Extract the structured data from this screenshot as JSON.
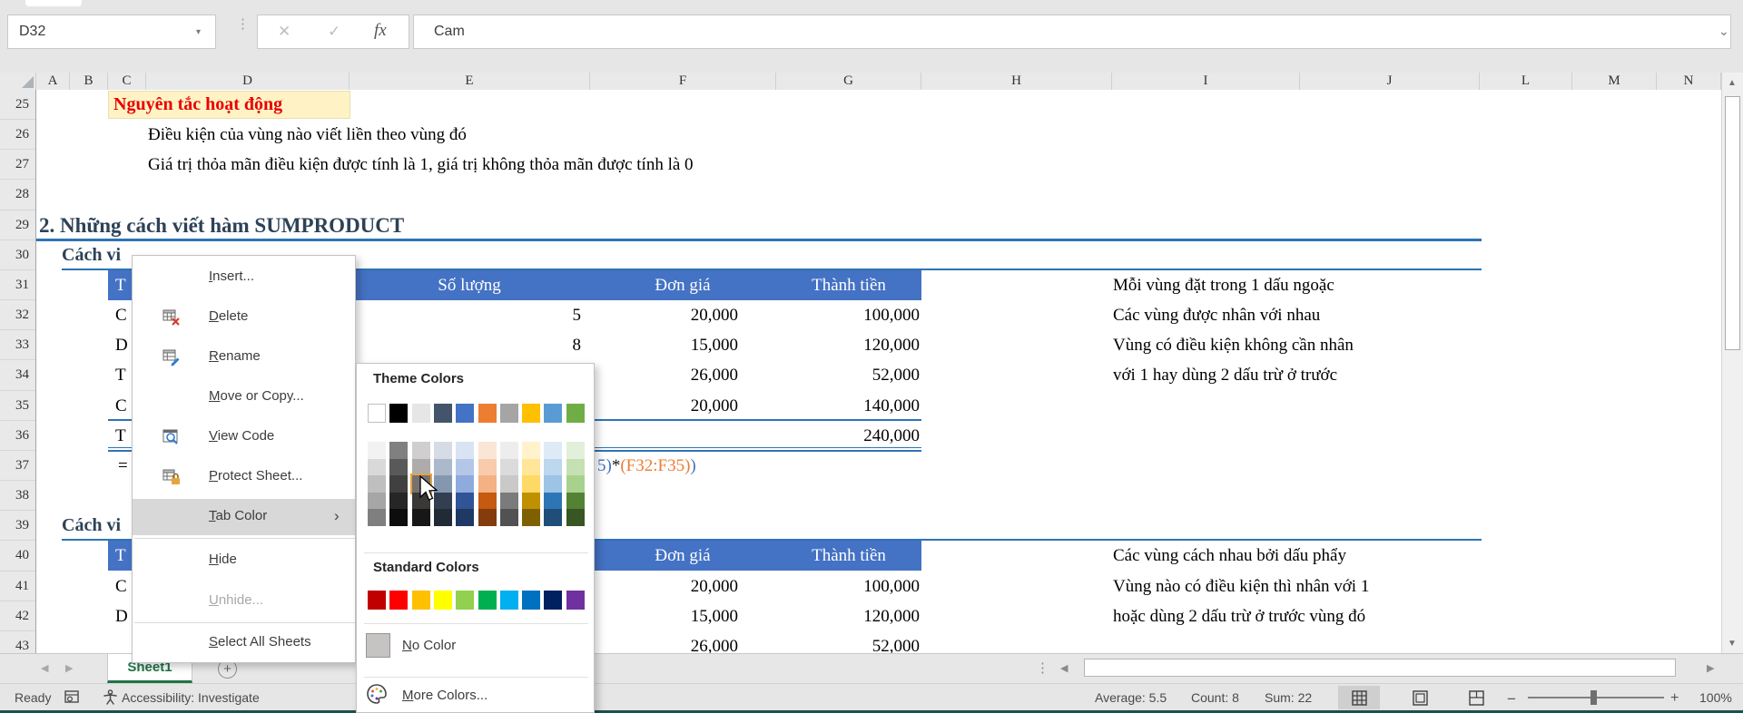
{
  "colors": {
    "accent_blue": "#4472C4",
    "line_blue": "#2E74B5",
    "heading_navy": "#2D4257",
    "note_red": "#EA0000",
    "note_bg": "#FFF3C5",
    "tab_green": "#217346",
    "formula_orange": "#ED7D31",
    "menu_highlight": "#D8D8D8"
  },
  "formula_bar": {
    "name_box": "D32",
    "cancel": "✕",
    "enter": "✓",
    "fx": "fx",
    "value": "Cam"
  },
  "grid": {
    "columns": [
      "A",
      "B",
      "C",
      "D",
      "E",
      "F",
      "G",
      "H",
      "I",
      "J",
      "L",
      "M",
      "N"
    ],
    "row_numbers": [
      "25",
      "26",
      "27",
      "28",
      "29",
      "30",
      "31",
      "32",
      "33",
      "34",
      "35",
      "36",
      "37",
      "38",
      "39",
      "40",
      "41",
      "42",
      "43"
    ]
  },
  "sheet": {
    "note_title": "Nguyên tắc hoạt động",
    "rule_line_1": "Điều kiện của vùng nào viết liền theo vùng đó",
    "rule_line_2": "Giá trị thỏa mãn điều kiện được tính là 1, giá trị không thỏa mãn được tính là 0",
    "section_heading": "2. Những cách viết hàm SUMPRODUCT",
    "sub_heading_1": "Cách vi",
    "sub_heading_2": "Cách vi",
    "table1": {
      "first_col_header": "T",
      "headers": [
        "Số lượng",
        "Đơn giá",
        "Thành tiền"
      ],
      "rows": [
        {
          "letter": "C",
          "qty": "5",
          "price": "20,000",
          "amount": "100,000"
        },
        {
          "letter": "D",
          "qty": "8",
          "price": "15,000",
          "amount": "120,000"
        },
        {
          "letter": "T",
          "qty": "",
          "price": "26,000",
          "amount": "52,000"
        },
        {
          "letter": "C",
          "qty": "",
          "price": "20,000",
          "amount": "140,000"
        }
      ],
      "total_letter": "T",
      "total": "240,000"
    },
    "formula_start": "=",
    "formula_fragment": [
      {
        "text": "5)",
        "color": "#4472C4"
      },
      {
        "text": "*",
        "color": "#1a1a1a"
      },
      {
        "text": "(F32:F35)",
        "color": "#ED7D31"
      },
      {
        "text": ")",
        "color": "#4472C4"
      }
    ],
    "table2": {
      "first_col_header": "T",
      "headers": [
        "Đơn giá",
        "Thành tiền"
      ],
      "rows": [
        {
          "letter": "C",
          "price": "20,000",
          "amount": "100,000"
        },
        {
          "letter": "D",
          "price": "15,000",
          "amount": "120,000"
        },
        {
          "letter": "",
          "price": "26,000",
          "amount": "52,000"
        }
      ]
    },
    "notes_block_1": [
      "Mỗi vùng đặt trong 1 dấu ngoặc",
      "Các vùng được nhân với nhau",
      "Vùng có điều kiện không cần nhân",
      "với 1 hay dùng 2 dấu trừ ở trước"
    ],
    "notes_block_2": [
      "Các vùng cách nhau bởi dấu phẩy",
      "Vùng nào có điều kiện thì nhân với 1",
      "hoặc dùng 2 dấu trừ ở trước vùng đó"
    ]
  },
  "context_menu": {
    "items": [
      {
        "label": "Insert...",
        "icon": "",
        "disabled": false,
        "submenu": false,
        "highlighted": false
      },
      {
        "label": "Delete",
        "icon": "delete-table-icon",
        "disabled": false,
        "submenu": false,
        "highlighted": false
      },
      {
        "label": "Rename",
        "icon": "rename-icon",
        "disabled": false,
        "submenu": false,
        "highlighted": false
      },
      {
        "label": "Move or Copy...",
        "icon": "",
        "disabled": false,
        "submenu": false,
        "highlighted": false
      },
      {
        "label": "View Code",
        "icon": "view-code-icon",
        "disabled": false,
        "submenu": false,
        "highlighted": false
      },
      {
        "label": "Protect Sheet...",
        "icon": "protect-sheet-icon",
        "disabled": false,
        "submenu": false,
        "highlighted": false
      },
      {
        "label": "Tab Color",
        "icon": "",
        "disabled": false,
        "submenu": true,
        "highlighted": true
      },
      {
        "label": "Hide",
        "icon": "",
        "disabled": false,
        "submenu": false,
        "highlighted": false
      },
      {
        "label": "Unhide...",
        "icon": "",
        "disabled": true,
        "submenu": false,
        "highlighted": false
      },
      {
        "label": "Select All Sheets",
        "icon": "",
        "disabled": false,
        "submenu": false,
        "highlighted": false
      }
    ]
  },
  "color_picker": {
    "theme_label": "Theme Colors",
    "standard_label": "Standard Colors",
    "no_color_label": "No Color",
    "more_colors_label": "More Colors...",
    "theme_colors": [
      "#FFFFFF",
      "#000000",
      "#E7E6E6",
      "#44546A",
      "#4472C4",
      "#ED7D31",
      "#A5A5A5",
      "#FFC000",
      "#5B9BD5",
      "#70AD47"
    ],
    "theme_variants": [
      [
        "#F2F2F2",
        "#808080",
        "#D0CECE",
        "#D6DCE5",
        "#DAE3F3",
        "#FBE5D6",
        "#EDEDED",
        "#FFF2CC",
        "#DEEBF7",
        "#E2EFDA"
      ],
      [
        "#D9D9D9",
        "#595959",
        "#AFABAB",
        "#ACB9CA",
        "#B4C7E7",
        "#F8CBAD",
        "#DBDBDB",
        "#FFE699",
        "#BDD7EE",
        "#C6E0B4"
      ],
      [
        "#BFBFBF",
        "#404040",
        "#767171",
        "#8497B0",
        "#8FAADC",
        "#F4B183",
        "#C9C9C9",
        "#FFD966",
        "#9DC3E6",
        "#A9D18E"
      ],
      [
        "#A6A6A6",
        "#262626",
        "#3B3838",
        "#333F50",
        "#2F5597",
        "#C55A11",
        "#7B7B7B",
        "#BF9000",
        "#2E75B6",
        "#548235"
      ],
      [
        "#7F7F7F",
        "#0D0D0D",
        "#171717",
        "#222B35",
        "#1F3864",
        "#843C0C",
        "#525252",
        "#7F6000",
        "#1F4E79",
        "#375623"
      ]
    ],
    "standard_colors": [
      "#C00000",
      "#FF0000",
      "#FFC000",
      "#FFFF00",
      "#92D050",
      "#00B050",
      "#00B0F0",
      "#0070C0",
      "#002060",
      "#7030A0"
    ],
    "highlight": {
      "row": 2,
      "col": 2
    }
  },
  "sheet_tabs": {
    "active": "Sheet1"
  },
  "status_bar": {
    "mode": "Ready",
    "accessibility": "Accessibility: Investigate",
    "average": "Average: 5.5",
    "count": "Count: 8",
    "sum": "Sum: 22",
    "zoom_level": "100%"
  }
}
